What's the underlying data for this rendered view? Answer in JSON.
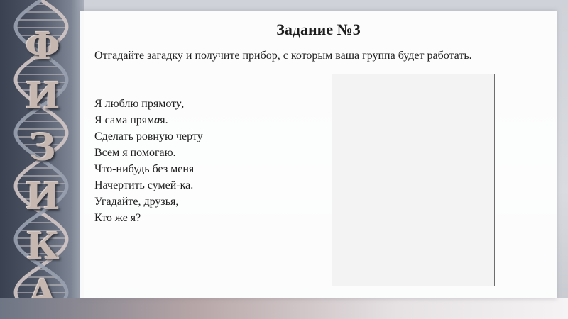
{
  "vertical_letters": [
    "Ф",
    "И",
    "З",
    "И",
    "К",
    "А"
  ],
  "task": {
    "title": "Задание №3",
    "intro": "Отгадайте загадку и получите прибор, с которым ваша группа будет работать."
  },
  "riddle": {
    "line1": {
      "pre": "Я люблю прямот",
      "em": "у",
      "post": ","
    },
    "line2": {
      "pre": "Я сама прям",
      "em": "а",
      "post": "я."
    },
    "line3": "Сделать ровную черту",
    "line4": "Всем я помогаю.",
    "line5": "Что-нибудь без меня",
    "line6": "Начертить сумей-ка.",
    "line7": "Угадайте, друзья,",
    "line8": "Кто же я?"
  }
}
